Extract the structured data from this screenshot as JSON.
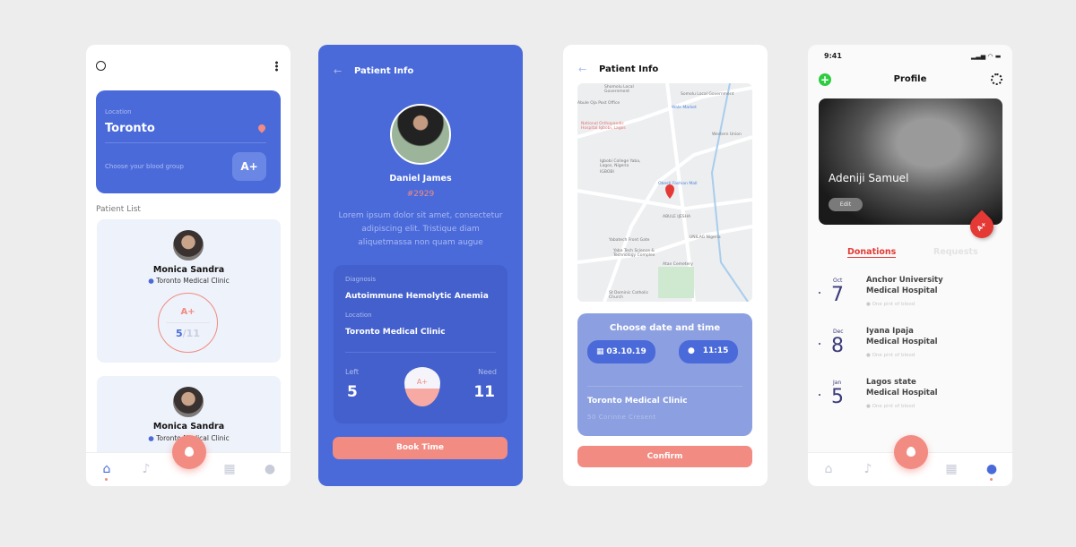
{
  "colors": {
    "primary": "#4a6ada",
    "accent": "#f28b82",
    "background": "#ededed"
  },
  "screen1": {
    "search_icon": "search-icon",
    "more_icon": "more-vertical-icon",
    "location_label": "Location",
    "location_value": "Toronto",
    "blood_group_prompt": "Choose your blood group",
    "blood_group": "A+",
    "section_title": "Patient List",
    "patients": [
      {
        "name": "Monica Sandra",
        "clinic": "Toronto Medical Clinic",
        "blood": "A+",
        "left": "5",
        "need": "/11"
      },
      {
        "name": "Monica Sandra",
        "clinic": "Toronto Medical Clinic"
      }
    ],
    "nav": [
      "home-icon",
      "bell-icon",
      "blood-drop-icon",
      "hospital-icon",
      "user-icon"
    ]
  },
  "screen2": {
    "title": "Patient Info",
    "name": "Daniel James",
    "id": "#2929",
    "description": "Lorem ipsum dolor sit amet, consectetur adipiscing elit. Tristique diam aliquetmassa non quam augue",
    "diagnosis_label": "Diagnosis",
    "diagnosis": "Autoimmune Hemolytic Anemia",
    "location_label": "Location",
    "location": "Toronto Medical Clinic",
    "left_label": "Left",
    "left": "5",
    "need_label": "Need",
    "need": "11",
    "blood": "A+",
    "book_button": "Book Time"
  },
  "screen3": {
    "title": "Patient Info",
    "map_labels": [
      "Shomolu Local Government",
      "Somolu Local Government",
      "Abule Oja Post Office",
      "Wale Market",
      "National Orthopaedic Hospital Igbobi, Lagos",
      "Western Union",
      "Igbobi College Yaba, Lagos, Nigeria",
      "IGBOBI",
      "Obesti Fashion Mall",
      "ABULE IJESHA",
      "Yabatech Front Gate",
      "UNILAG Nigeria",
      "Yaba Tech Science & Technology Complex",
      "Atan Cemetery",
      "St Dominic Catholic Church"
    ],
    "panel_title": "Choose date and time",
    "date": "03.10.19",
    "time": "11:15",
    "clinic": "Toronto Medical Clinic",
    "address": "50 Corinne Cresent",
    "confirm_button": "Confirm"
  },
  "screen4": {
    "status_time": "9:41",
    "title": "Profile",
    "name": "Adeniji Samuel",
    "edit_button": "Edit",
    "blood": "A+",
    "tabs": [
      "Donations",
      "Requests"
    ],
    "donations": [
      {
        "month": "Oct",
        "day": "7",
        "line1": "Anchor University",
        "line2": "Medical Hospital",
        "note": "One pint of blood"
      },
      {
        "month": "Dec",
        "day": "8",
        "line1": "Iyana Ipaja",
        "line2": "Medical Hospital",
        "note": "One pint of blood"
      },
      {
        "month": "Jan",
        "day": "5",
        "line1": "Lagos state",
        "line2": "Medical Hospital",
        "note": "One pint of blood"
      }
    ]
  }
}
